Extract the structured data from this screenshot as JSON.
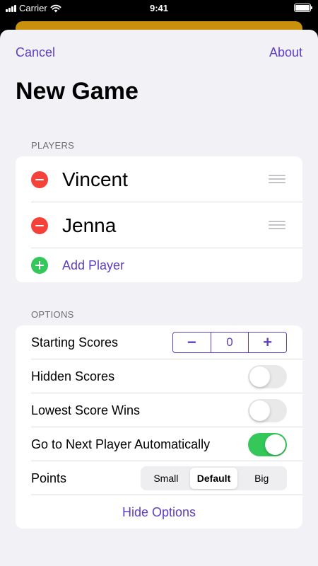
{
  "status_bar": {
    "carrier": "Carrier",
    "time": "9:41",
    "battery_level": 1.0
  },
  "nav": {
    "cancel_label": "Cancel",
    "about_label": "About"
  },
  "title": "New Game",
  "players": {
    "section_header": "PLAYERS",
    "list": [
      {
        "name": "Vincent"
      },
      {
        "name": "Jenna"
      }
    ],
    "add_label": "Add Player"
  },
  "options": {
    "section_header": "OPTIONS",
    "starting_scores": {
      "label": "Starting Scores",
      "value": "0",
      "minus": "−",
      "plus": "+"
    },
    "hidden_scores": {
      "label": "Hidden Scores",
      "on": false
    },
    "lowest_score_wins": {
      "label": "Lowest Score Wins",
      "on": false
    },
    "next_player_auto": {
      "label": "Go to Next Player Automatically",
      "on": true
    },
    "points": {
      "label": "Points",
      "options": [
        "Small",
        "Default",
        "Big"
      ],
      "selected": "Default"
    },
    "hide_label": "Hide Options"
  },
  "colors": {
    "accent": "#5e3fc0",
    "remove": "#f4413a",
    "add": "#34c759",
    "toggle_on": "#34c759",
    "behind_sheet": "#c8900b"
  }
}
